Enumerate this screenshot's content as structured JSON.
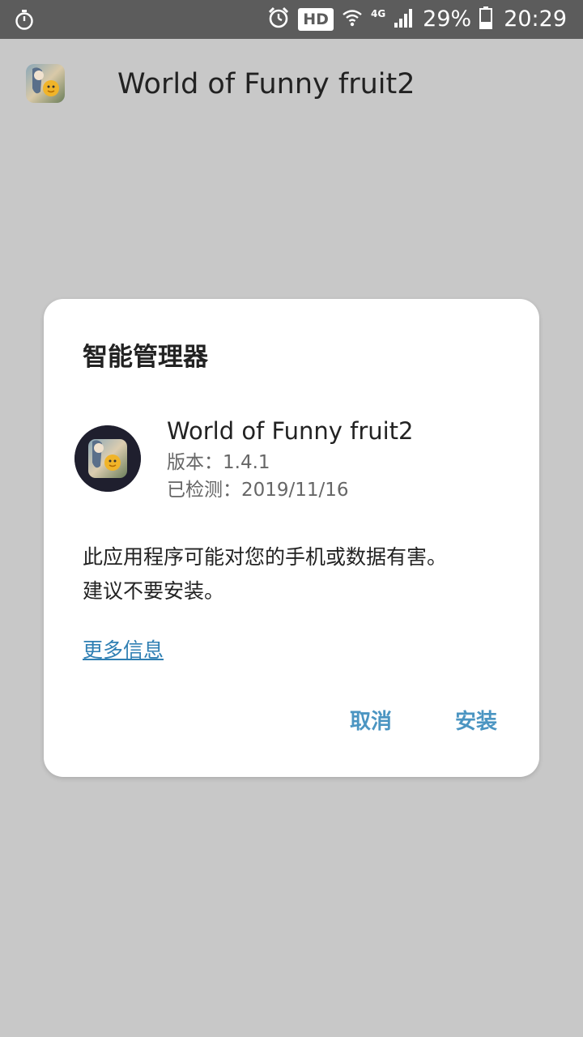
{
  "status_bar": {
    "left_icon": "stopwatch-icon",
    "icons": [
      "alarm-icon",
      "hd-badge",
      "wifi-icon",
      "4g-icon",
      "signal-icon",
      "battery-icon"
    ],
    "hd": "HD",
    "network": "4G",
    "battery": "29%",
    "time": "20:29"
  },
  "header": {
    "app_icon": "app-icon",
    "title": "World of Funny fruit2"
  },
  "dialog": {
    "title": "智能管理器",
    "app_name": "World of Funny fruit2",
    "version": "版本：1.4.1",
    "scanned": "已检测：2019/11/16",
    "warning_line1": "此应用程序可能对您的手机或数据有害。",
    "warning_line2": "建议不要安装。",
    "more_info": "更多信息",
    "cancel": "取消",
    "install": "安装",
    "accent_color": "#4b95c2",
    "link_color": "#2f7fb3"
  }
}
